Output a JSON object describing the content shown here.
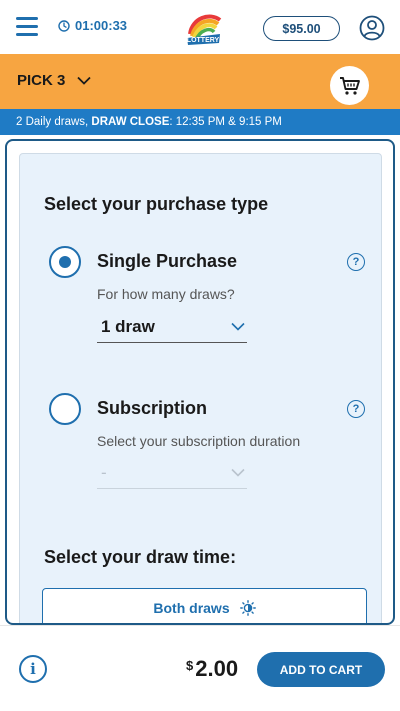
{
  "header": {
    "timer": "01:00:33",
    "balance": "$95.00",
    "logo_text": "LOTTERY"
  },
  "game": {
    "title": "PICK 3"
  },
  "draw_info": {
    "prefix": "2 Daily draws,",
    "label": "DRAW CLOSE",
    "times": ": 12:35 PM & 9:15 PM"
  },
  "purchase": {
    "title": "Select your purchase type",
    "single": {
      "label": "Single Purchase",
      "prompt": "For how many draws?",
      "selected": "1 draw",
      "checked": true
    },
    "subscription": {
      "label": "Subscription",
      "prompt": "Select your subscription duration",
      "selected": "-",
      "checked": false
    }
  },
  "draw_time": {
    "title": "Select your draw time:",
    "option": "Both draws"
  },
  "footer": {
    "currency": "$",
    "amount": "2.00",
    "add_label": "ADD TO CART"
  },
  "colors": {
    "primary_blue": "#1f6fae",
    "game_orange": "#f7a541",
    "info_blue": "#1f7bc5",
    "panel_bg": "#e8f2fb"
  }
}
